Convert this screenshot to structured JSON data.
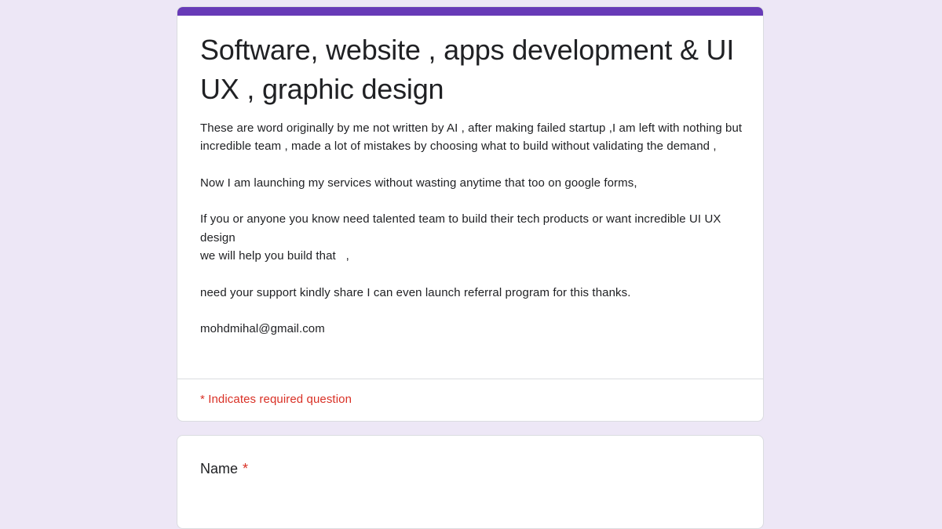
{
  "form": {
    "title": "Software, website , apps development & UI UX , graphic design",
    "description": "These are word originally by me not written by AI , after making failed startup ,I am left with nothing but incredible team , made a lot of mistakes by choosing what to build without validating the demand ,\n\nNow I am launching my services without wasting anytime that too on google forms,\n\nIf you or anyone you know need talented team to build their tech products or want incredible UI UX design\nwe will help you build that   ,\n\nneed your support kindly share I can even launch referral program for this thanks.\n\nmohdmihal@gmail.com",
    "required_note": "* Indicates required question"
  },
  "questions": [
    {
      "label": "Name",
      "required_marker": "*"
    }
  ],
  "colors": {
    "background": "#ede7f6",
    "accent": "#673ab7",
    "required": "#d93025",
    "text": "#202124"
  }
}
